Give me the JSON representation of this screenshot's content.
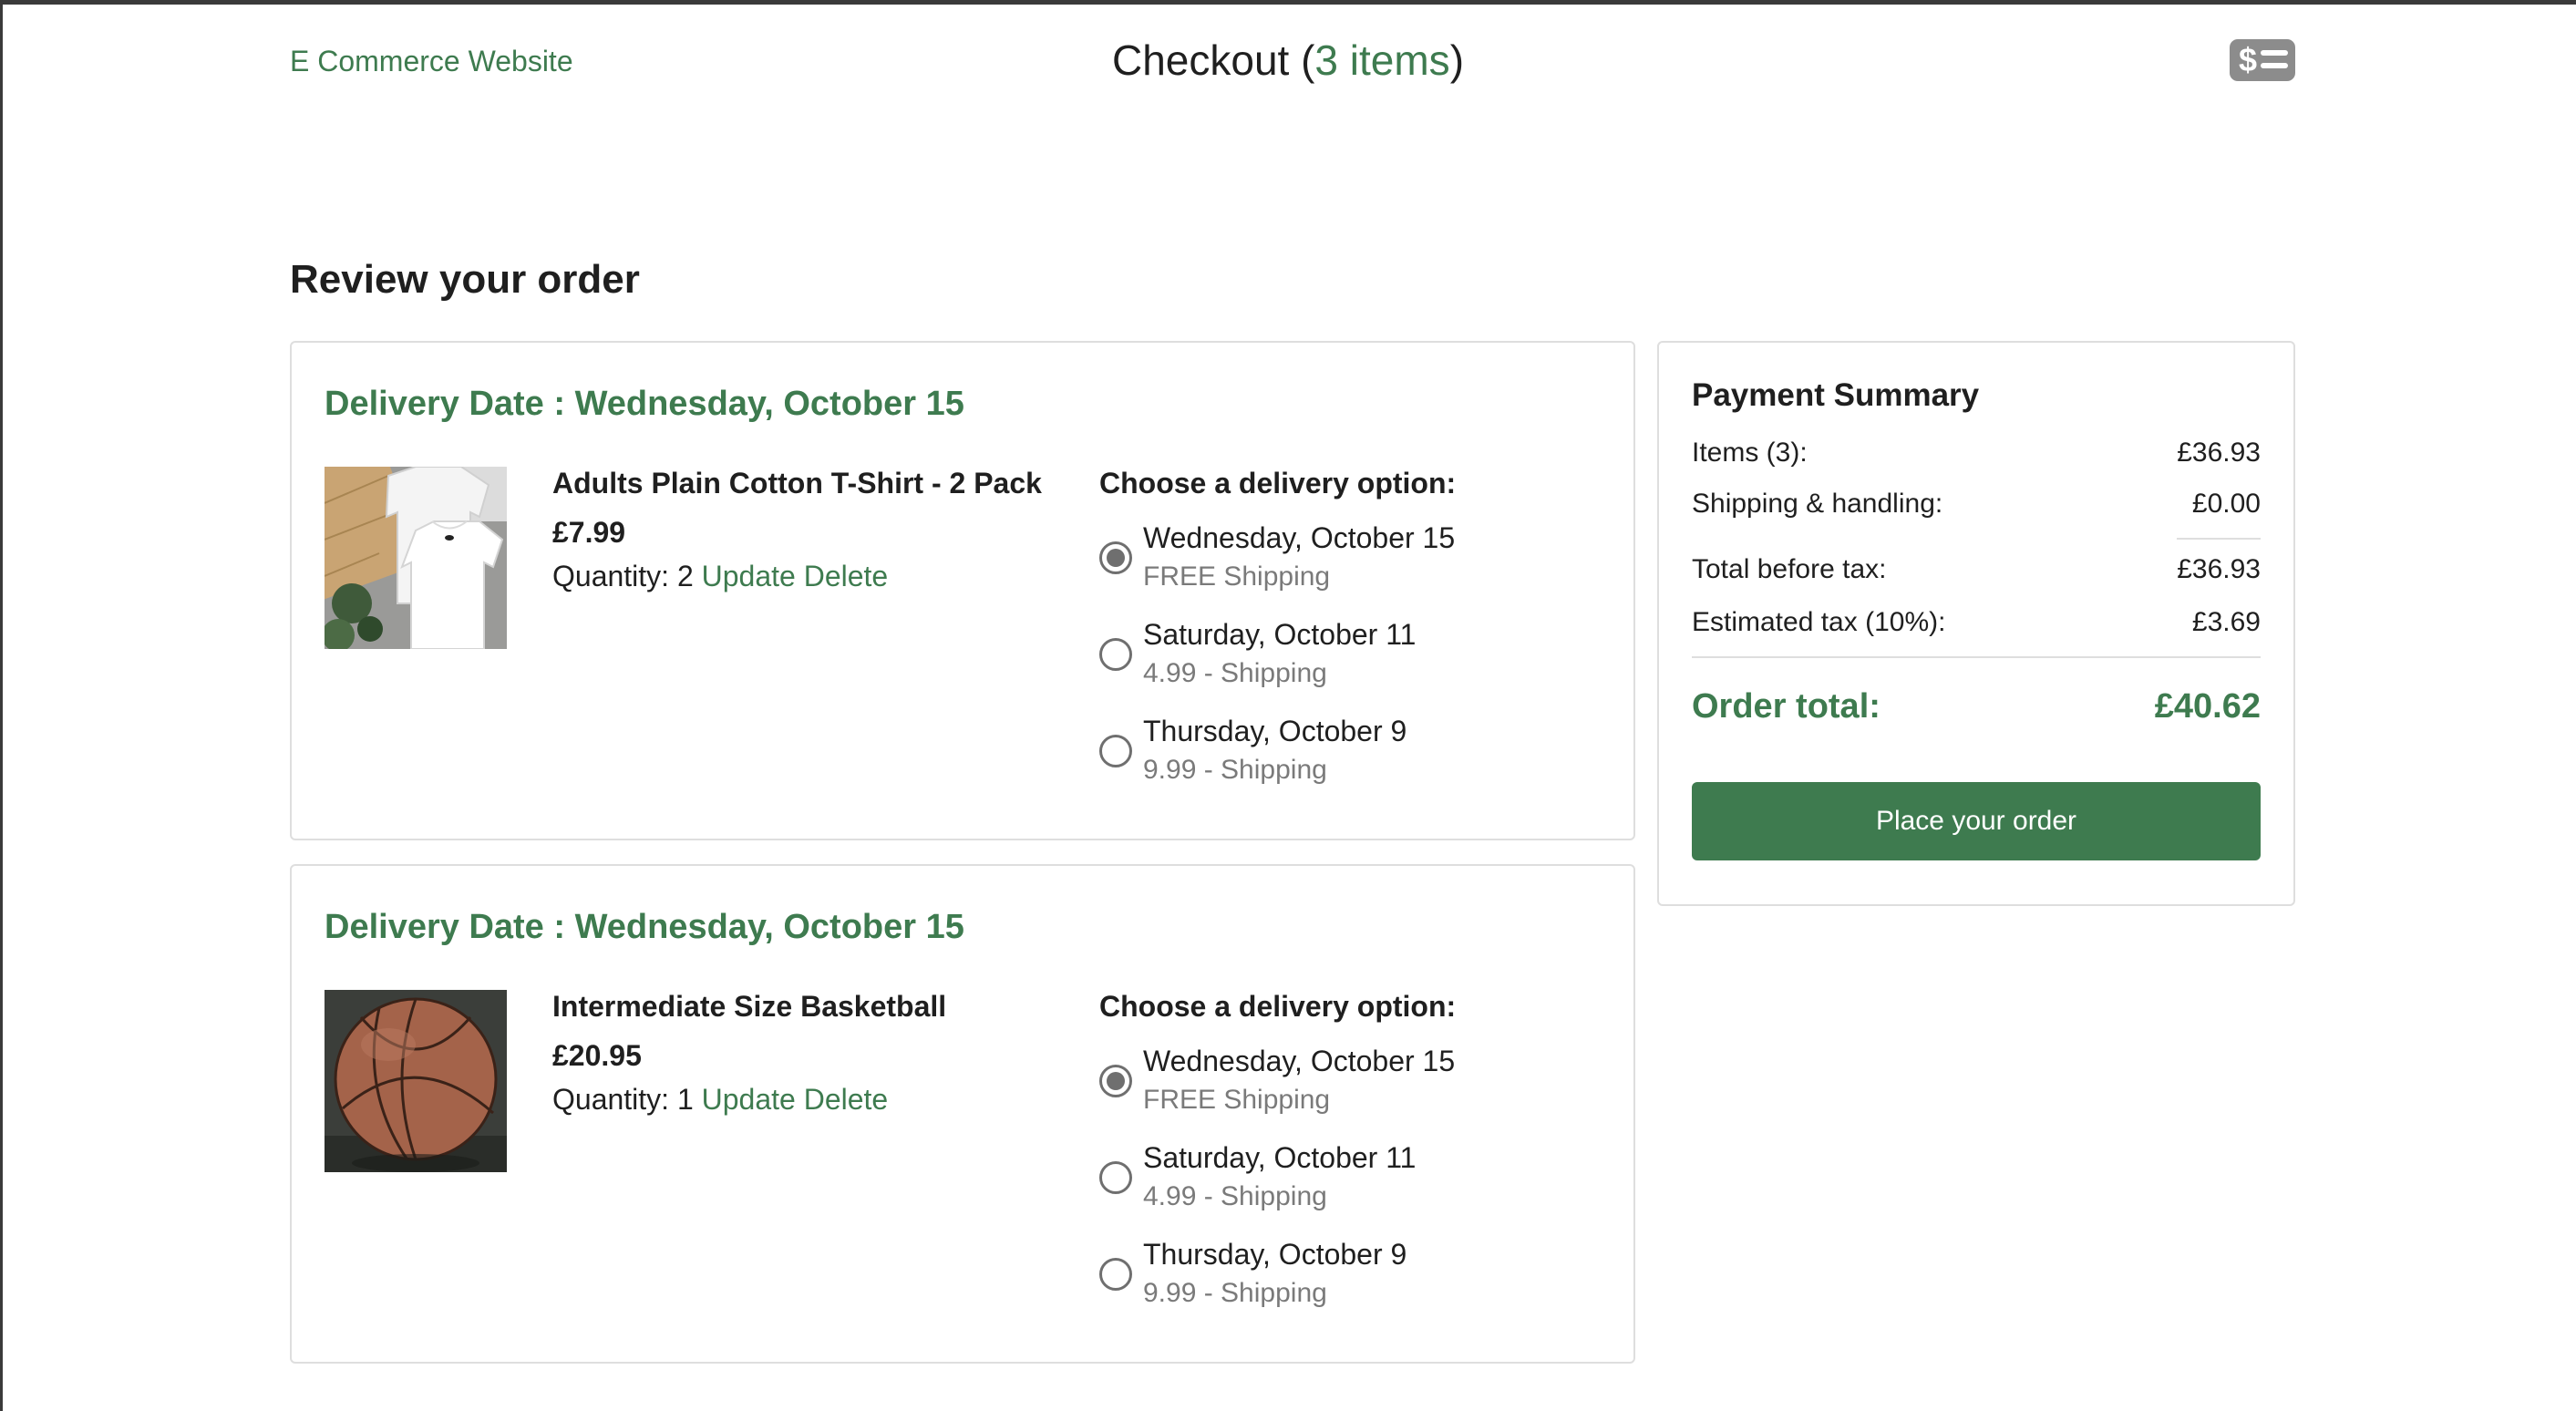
{
  "header": {
    "brand": "E Commerce Website",
    "title_prefix": "Checkout (",
    "item_count": "3 items",
    "title_suffix": ")",
    "checkout_icon": "dollar-list-icon"
  },
  "page_title": "Review your order",
  "orders": [
    {
      "delivery_date": "Delivery Date : Wednesday, October 15",
      "product_name": "Adults Plain Cotton T-Shirt - 2 Pack",
      "price": "£7.99",
      "quantity_label": "Quantity: ",
      "quantity": "2",
      "update_label": "Update",
      "delete_label": "Delete",
      "choose_label": "Choose a delivery option:",
      "options": [
        {
          "date": "Wednesday, October 15",
          "shipping": "FREE Shipping",
          "selected": true
        },
        {
          "date": "Saturday, October 11",
          "shipping": "4.99 - Shipping",
          "selected": false
        },
        {
          "date": "Thursday, October 9",
          "shipping": "9.99 - Shipping",
          "selected": false
        }
      ]
    },
    {
      "delivery_date": "Delivery Date : Wednesday, October 15",
      "product_name": "Intermediate Size Basketball",
      "price": "£20.95",
      "quantity_label": "Quantity: ",
      "quantity": "1",
      "update_label": "Update",
      "delete_label": "Delete",
      "choose_label": "Choose a delivery option:",
      "options": [
        {
          "date": "Wednesday, October 15",
          "shipping": "FREE Shipping",
          "selected": true
        },
        {
          "date": "Saturday, October 11",
          "shipping": "4.99 - Shipping",
          "selected": false
        },
        {
          "date": "Thursday, October 9",
          "shipping": "9.99 - Shipping",
          "selected": false
        }
      ]
    }
  ],
  "summary": {
    "title": "Payment Summary",
    "items_label": "Items (3):",
    "items_value": "£36.93",
    "shipping_label": "Shipping & handling:",
    "shipping_value": "£0.00",
    "before_tax_label": "Total before tax:",
    "before_tax_value": "£36.93",
    "tax_label": "Estimated tax (10%):",
    "tax_value": "£3.69",
    "total_label": "Order total:",
    "total_value": "£40.62",
    "button_label": "Place your order"
  },
  "colors": {
    "accent": "#3e7b4f",
    "muted_text": "#7a7a7a",
    "border": "#dedede",
    "icon_gray": "#8c8c8c"
  }
}
